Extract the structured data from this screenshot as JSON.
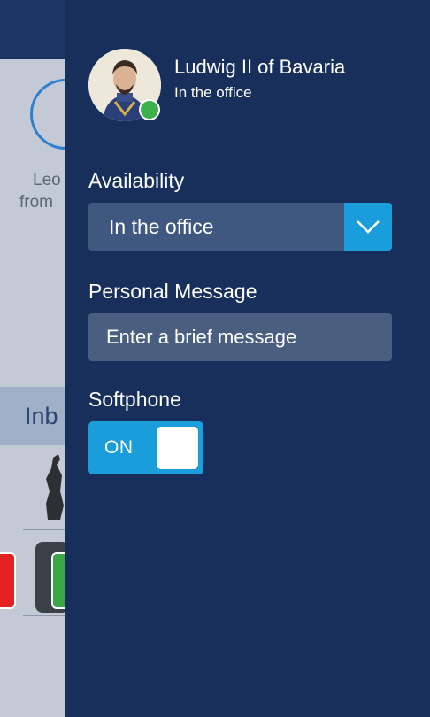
{
  "background_app": {
    "contact_lines": [
      "Leo",
      "from"
    ],
    "inbox_label": "Inb"
  },
  "profile": {
    "name": "Ludwig II of Bavaria",
    "status_text": "In the office",
    "presence_color": "#3db14a"
  },
  "availability": {
    "label": "Availability",
    "selected": "In the office"
  },
  "personal_message": {
    "label": "Personal Message",
    "placeholder": "Enter a brief message",
    "value": ""
  },
  "softphone": {
    "label": "Softphone",
    "state_label": "ON",
    "enabled": true
  },
  "colors": {
    "panel": "#182f5c",
    "accent": "#1a9ddb",
    "field": "#3f5880"
  }
}
